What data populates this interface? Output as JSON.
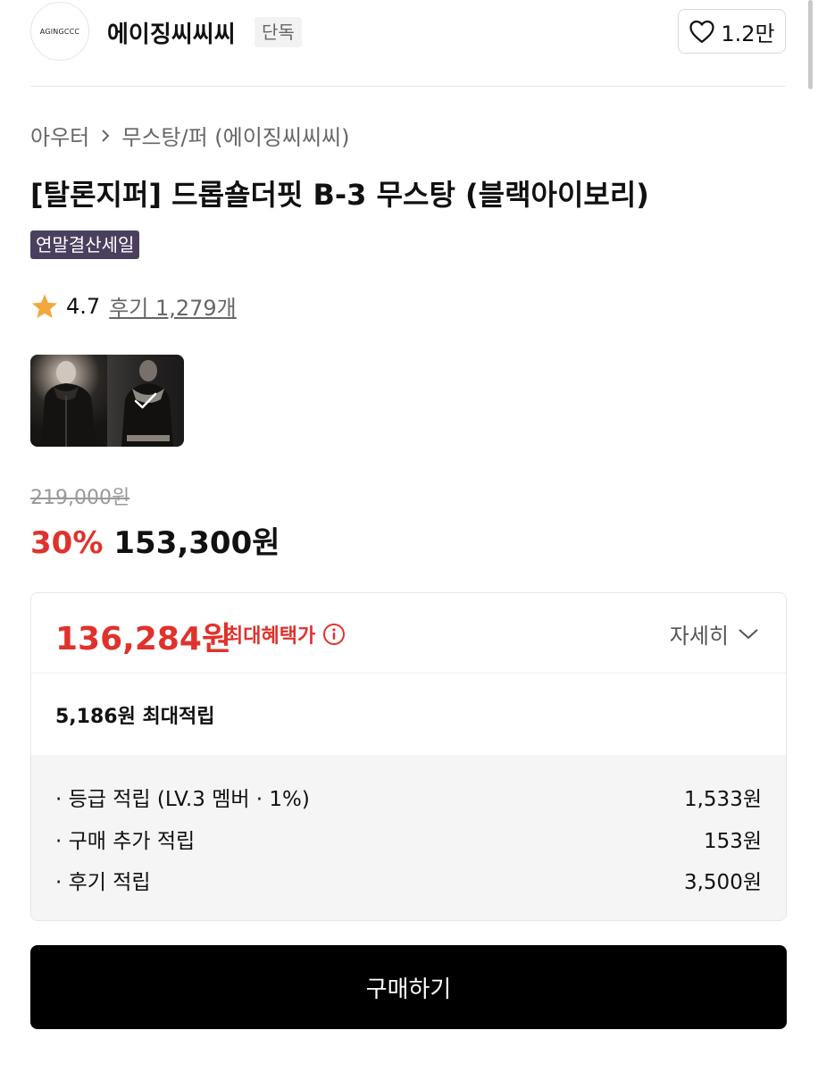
{
  "brand": {
    "logo_text": "AGINGCCC",
    "name": "에이징씨씨씨",
    "badge": "단독"
  },
  "like": {
    "count": "1.2만",
    "icon": "heart-outline-icon"
  },
  "breadcrumb": {
    "category": "아우터",
    "separator_icon": "chevron-right-icon",
    "subcategory": "무스탕/퍼 (에이징씨씨씨)"
  },
  "product": {
    "title": "[탈론지퍼] 드롭숄더핏 B-3 무스탕 (블랙아이보리)",
    "promo_badge": "연말결산세일"
  },
  "rating": {
    "icon": "star-icon",
    "score": "4.7",
    "reviews": "후기 1,279개",
    "star_color": "#f2a93b"
  },
  "thumbnails": [
    {
      "name": "black-jacket",
      "selected": false
    },
    {
      "name": "ivory-collar-jacket",
      "selected": true
    }
  ],
  "price": {
    "original": "219,000원",
    "discount": "30%",
    "sale": "153,300원"
  },
  "benefit": {
    "max_price": "136,284원",
    "max_label": "최대혜택가",
    "detail_toggle": "자세히",
    "points_max": "5,186원 최대적립",
    "points": [
      {
        "label": "· 등급 적립 (LV.3 멤버 · 1%)",
        "value": "1,533원"
      },
      {
        "label": "· 구매 추가 적립",
        "value": "153원"
      },
      {
        "label": "· 후기 적립",
        "value": "3,500원"
      }
    ]
  },
  "buy_button": "구매하기",
  "colors": {
    "accent_red": "#e0322c",
    "badge_purple": "#4a405e",
    "button_black": "#000000"
  }
}
